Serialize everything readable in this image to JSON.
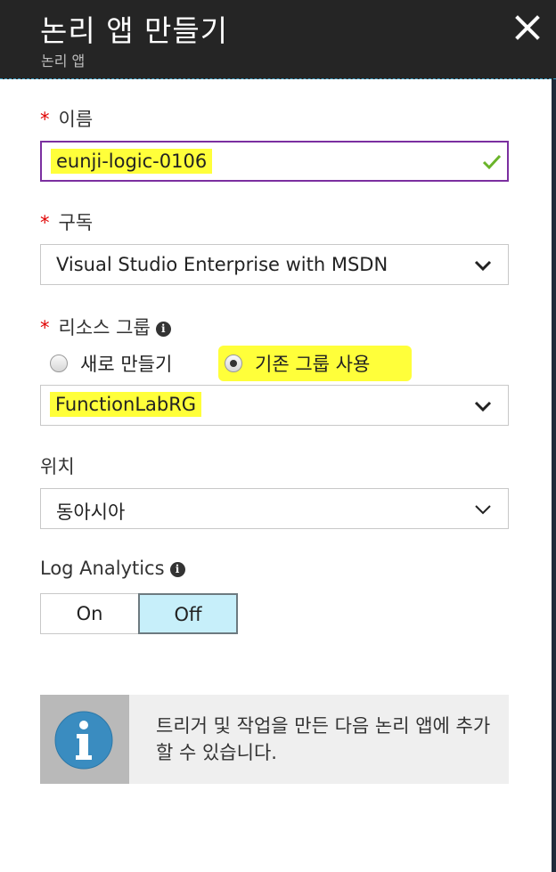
{
  "header": {
    "title": "논리 앱 만들기",
    "subtitle": "논리 앱"
  },
  "name": {
    "label": "이름",
    "required": "*",
    "value": "eunji-logic-0106",
    "valid": true
  },
  "subscription": {
    "label": "구독",
    "required": "*",
    "value": "Visual Studio Enterprise with MSDN"
  },
  "resource_group": {
    "label": "리소스 그룹",
    "required": "*",
    "info": "i",
    "options": [
      "새로 만들기",
      "기존 그룹 사용"
    ],
    "selected_option": "기존 그룹 사용",
    "value": "FunctionLabRG"
  },
  "location": {
    "label": "위치",
    "value": "동아시아"
  },
  "log_analytics": {
    "label": "Log Analytics",
    "info": "i",
    "on_label": "On",
    "off_label": "Off",
    "selected": "Off"
  },
  "info_banner": {
    "icon": "info-icon",
    "text": "트리거 및 작업을 만든 다음 논리 앱에 추가할 수 있습니다."
  },
  "colors": {
    "header_bg": "#252525",
    "accent": "#7b2fa0",
    "highlight": "#ffff3a",
    "toggle_selected": "#c7effa",
    "check": "#6ab42a",
    "required": "#e00000"
  }
}
